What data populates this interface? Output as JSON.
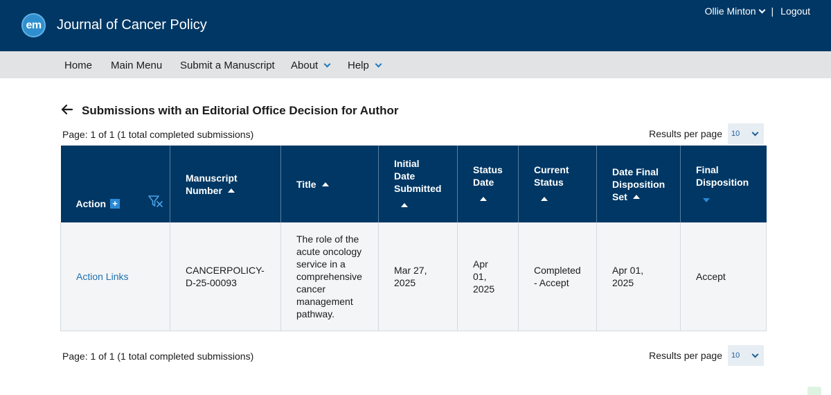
{
  "header": {
    "logo_text": "em",
    "journal_title": "Journal of Cancer Policy",
    "user_name": "Ollie Minton",
    "separator": "|",
    "logout_label": "Logout"
  },
  "nav": {
    "home": "Home",
    "main_menu": "Main Menu",
    "submit": "Submit a Manuscript",
    "about": "About",
    "help": "Help"
  },
  "page": {
    "title": "Submissions with an Editorial Office Decision for Author",
    "page_info": "Page: 1 of 1 (1 total completed submissions)",
    "results_per_page_label": "Results per page",
    "results_per_page_value": "10"
  },
  "table": {
    "headers": {
      "action": "Action",
      "manuscript_number": "Manuscript Number",
      "title": "Title",
      "initial_date": "Initial Date Submitted",
      "status_date": "Status Date",
      "current_status": "Current Status",
      "date_final": "Date Final Disposition Set",
      "final_disposition": "Final Disposition"
    },
    "rows": [
      {
        "action": "Action Links",
        "manuscript_number": "CANCERPOLICY-D-25-00093",
        "title": "The role of the acute oncology service in a comprehensive cancer management pathway.",
        "initial_date": "Mar 27, 2025",
        "status_date": "Apr 01, 2025",
        "current_status": "Completed - Accept",
        "date_final": "Apr 01, 2025",
        "final_disposition": "Accept"
      }
    ]
  },
  "icons": {
    "back": "back-arrow-icon",
    "add": "plus-icon",
    "filter_clear": "filter-clear-icon",
    "sort_asc": "sort-ascending-icon",
    "sort_desc": "sort-descending-icon"
  },
  "colors": {
    "header_bg": "#003764",
    "nav_bg": "#e1e3e5",
    "accent": "#2b8ad6",
    "link": "#1f6fae"
  }
}
